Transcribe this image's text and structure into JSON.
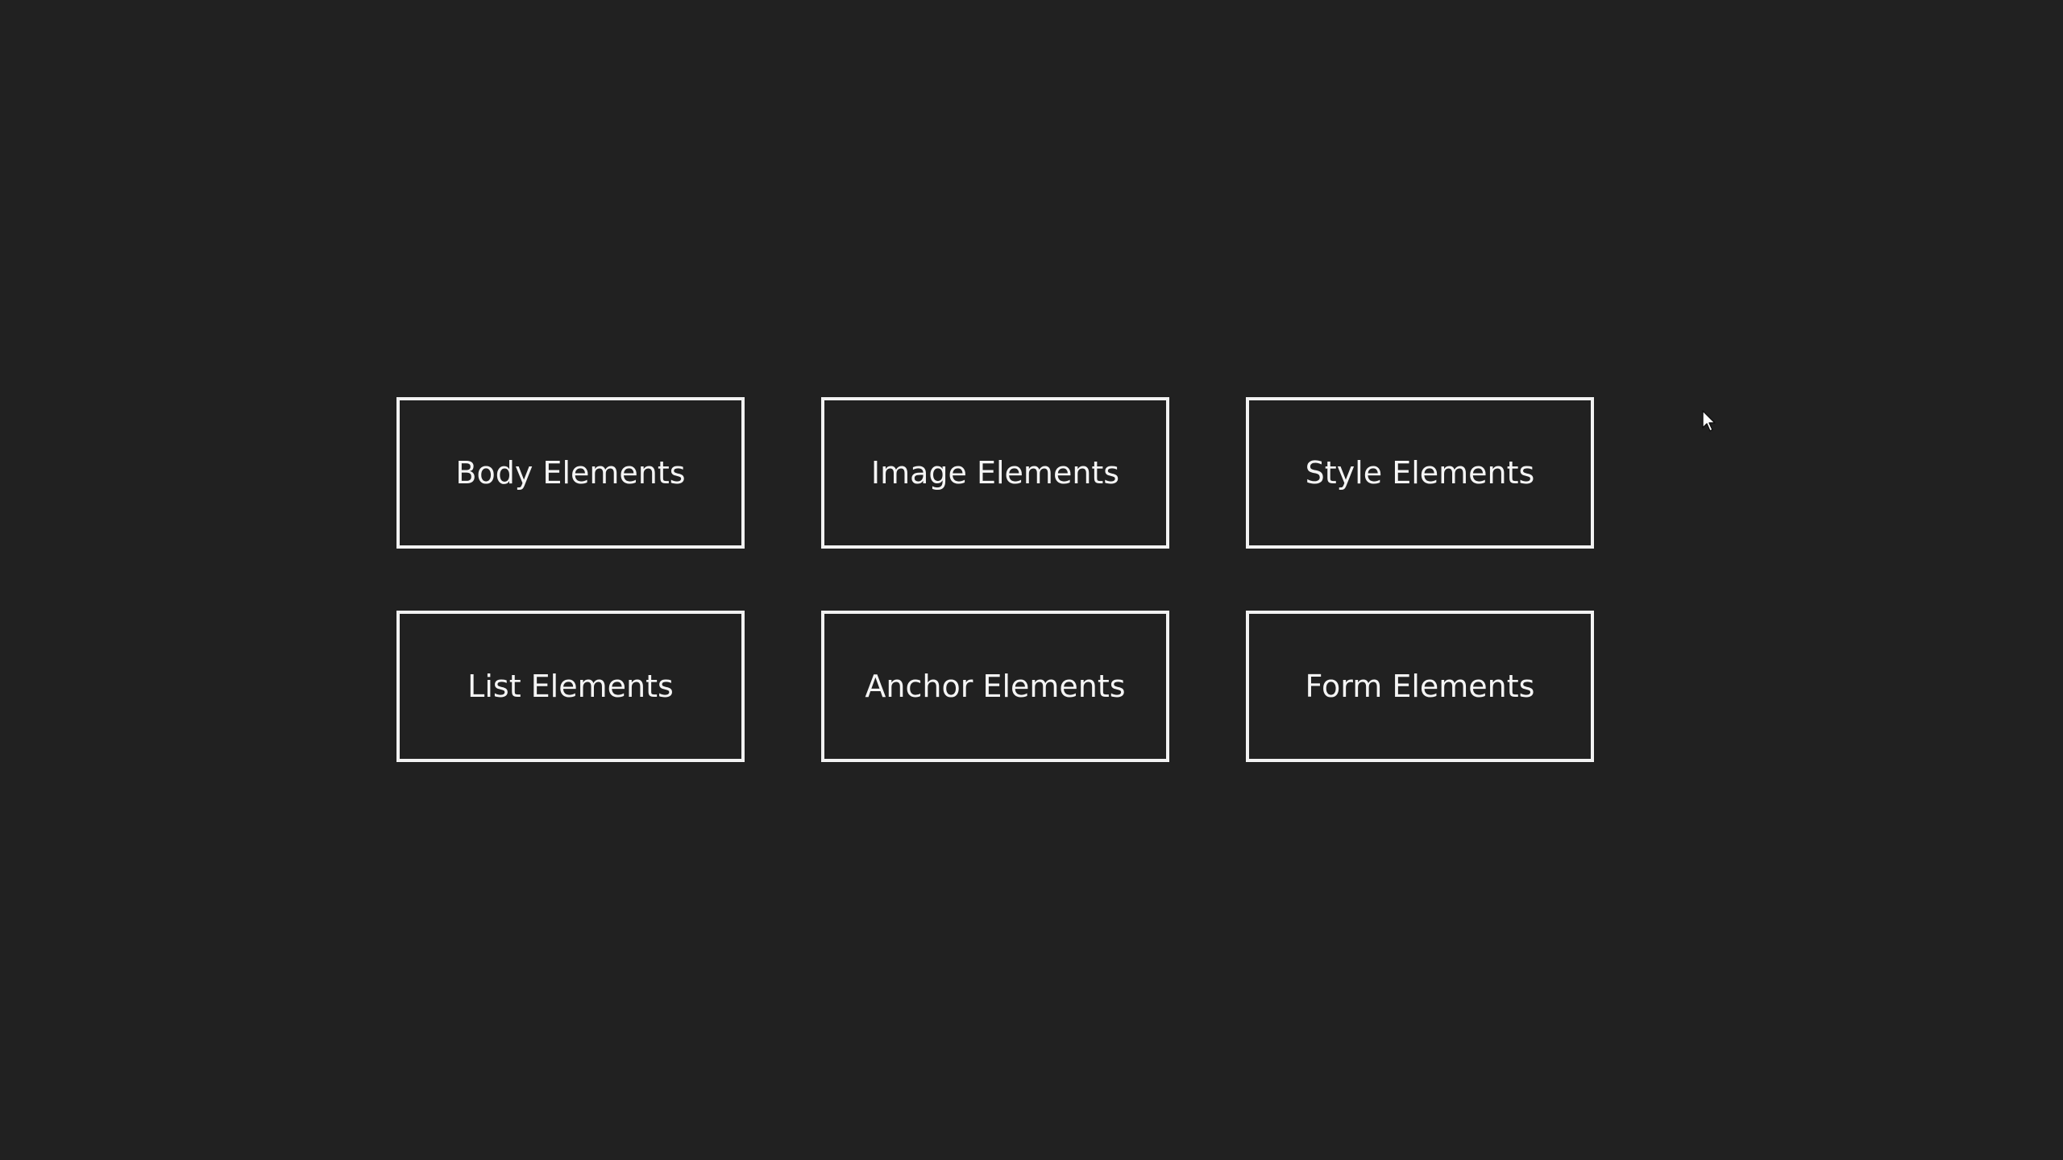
{
  "buttons": [
    {
      "label": "Body Elements"
    },
    {
      "label": "Image Elements"
    },
    {
      "label": "Style Elements"
    },
    {
      "label": "List Elements"
    },
    {
      "label": "Anchor Elements"
    },
    {
      "label": "Form Elements"
    }
  ],
  "colors": {
    "background": "#212121",
    "border": "#f2f2f2",
    "text": "#f5f5f5"
  },
  "icons": {
    "cursor": "mouse-pointer-icon"
  }
}
